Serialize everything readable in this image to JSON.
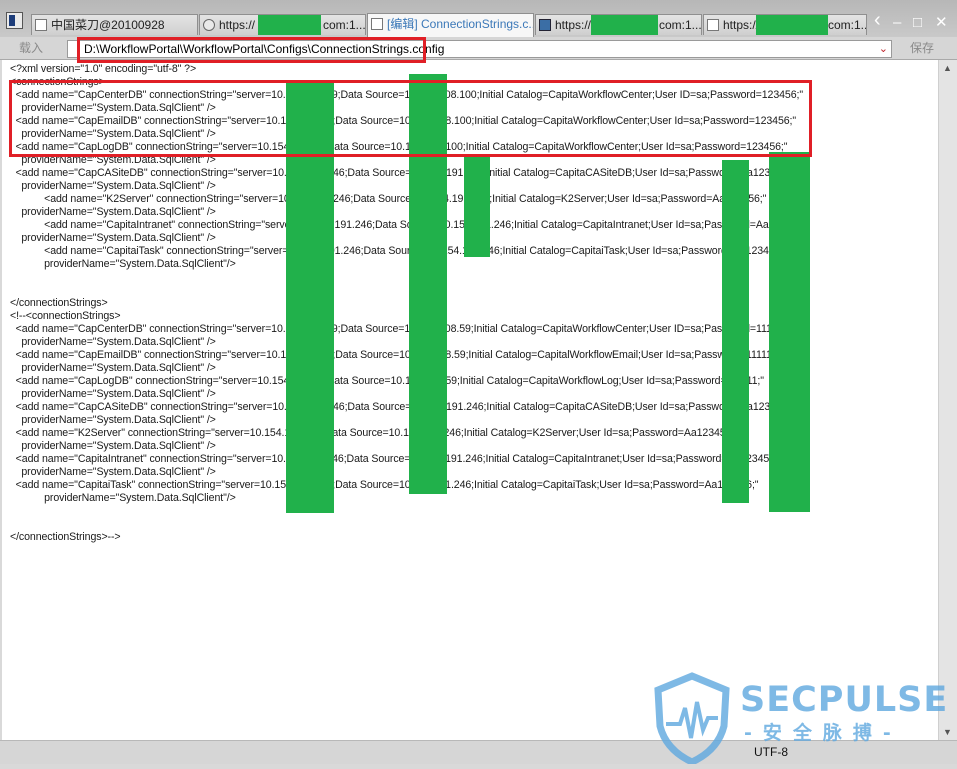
{
  "tabs": [
    {
      "label": "中国菜刀@20100928",
      "active": false,
      "icon": "window-icon"
    },
    {
      "label": "https://",
      "suffix": "com:1...",
      "active": false,
      "icon": "ie-icon"
    },
    {
      "label": "[编辑] ConnectionStrings.c...",
      "active": true,
      "icon": "document-icon"
    },
    {
      "label": "https://",
      "suffix": "com:1...",
      "active": false,
      "icon": "tile-icon"
    },
    {
      "label": "https://",
      "suffix": "com:1...",
      "active": false,
      "icon": "document-icon"
    }
  ],
  "window_controls": {
    "back": "‹",
    "minimize": "‒",
    "maximize": "□",
    "close": "✕"
  },
  "toolbar": {
    "load_label": "载入",
    "path": "D:\\WorkflowPortal\\WorkflowPortal\\Configs\\ConnectionStrings.config",
    "save_label": "保存"
  },
  "editor": {
    "lines": [
      "<?xml version=\"1.0\" encoding=\"utf-8\" ?>",
      "<connectionStrings>",
      "  <add name=\"CapCenterDB\" connectionString=\"server=10.154.108.59;Data Source=10.154.108.100;Initial Catalog=CapitaWorkflowCenter;User ID=sa;Password=123456;\"",
      "    providerName=\"System.Data.SqlClient\" />",
      "  <add name=\"CapEmailDB\" connectionString=\"server=10.154.108.59;Data Source=10.154.108.100;Initial Catalog=CapitaWorkflowCenter;User Id=sa;Password=123456;\"",
      "    providerName=\"System.Data.SqlClient\" />",
      "  <add name=\"CapLogDB\" connectionString=\"server=10.154.108.59;Data Source=10.154.108.100;Initial Catalog=CapitaWorkflowCenter;User Id=sa;Password=123456;\"",
      "    providerName=\"System.Data.SqlClient\" />",
      "  <add name=\"CapCASiteDB\" connectionString=\"server=10.154.191.246;Data Source=10.154.191.246;Initial Catalog=CapitaCASiteDB;User Id=sa;Password=Aa123456;\"",
      "    providerName=\"System.Data.SqlClient\" />",
      "            <add name=\"K2Server\" connectionString=\"server=10.154.191.246;Data Source=10.154.191.246;Initial Catalog=K2Server;User Id=sa;Password=Aa123456;\"",
      "    providerName=\"System.Data.SqlClient\" />",
      "            <add name=\"CapitaIntranet\" connectionString=\"server=10.154.191.246;Data Source=10.154.191.246;Initial Catalog=CapitaIntranet;User Id=sa;Password=Aa123456;\"",
      "    providerName=\"System.Data.SqlClient\" />",
      "            <add name=\"CapitaiTask\" connectionString=\"server=10.154.191.246;Data Source=10.154.191.246;Initial Catalog=CapitaiTask;User Id=sa;Password=Aa123456;\"",
      "            providerName=\"System.Data.SqlClient\"/>",
      "",
      "",
      "</connectionStrings>",
      "<!--<connectionStrings>",
      "  <add name=\"CapCenterDB\" connectionString=\"server=10.154.108.59;Data Source=10.154.108.59;Initial Catalog=CapitaWorkflowCenter;User ID=sa;Password=111111;\"",
      "    providerName=\"System.Data.SqlClient\" />",
      "  <add name=\"CapEmailDB\" connectionString=\"server=10.154.108.59;Data Source=10.154.108.59;Initial Catalog=CapitalWorkflowEmail;User Id=sa;Password=111111;\"",
      "    providerName=\"System.Data.SqlClient\" />",
      "  <add name=\"CapLogDB\" connectionString=\"server=10.154.108.59;Data Source=10.154.108.59;Initial Catalog=CapitaWorkflowLog;User Id=sa;Password=111111;\"",
      "    providerName=\"System.Data.SqlClient\" />",
      "  <add name=\"CapCASiteDB\" connectionString=\"server=10.154.191.246;Data Source=10.154.191.246;Initial Catalog=CapitaCASiteDB;User Id=sa;Password=Aa123456;\"",
      "    providerName=\"System.Data.SqlClient\" />",
      "  <add name=\"K2Server\" connectionString=\"server=10.154.191.246;Data Source=10.154.191.246;Initial Catalog=K2Server;User Id=sa;Password=Aa123456;\"",
      "    providerName=\"System.Data.SqlClient\" />",
      "  <add name=\"CapitaIntranet\" connectionString=\"server=10.154.191.246;Data Source=10.154.191.246;Initial Catalog=CapitaIntranet;User Id=sa;Password=Aa123456;\"",
      "    providerName=\"System.Data.SqlClient\" />",
      "  <add name=\"CapitaiTask\" connectionString=\"server=10.154.191.246;Data Source=10.154.191.246;Initial Catalog=CapitaiTask;User Id=sa;Password=Aa123456;\"",
      "            providerName=\"System.Data.SqlClient\"/>",
      "",
      "",
      "</connectionStrings>-->"
    ]
  },
  "statusbar": {
    "encoding": "UTF-8"
  },
  "watermark": {
    "title": "SECPULSE",
    "subtitle": "-安全脉搏-"
  },
  "colors": {
    "redact": "#21b14b",
    "highlight": "#e01f26",
    "watermark": "#5fa8df",
    "active_tab_text": "#3b78b8"
  }
}
